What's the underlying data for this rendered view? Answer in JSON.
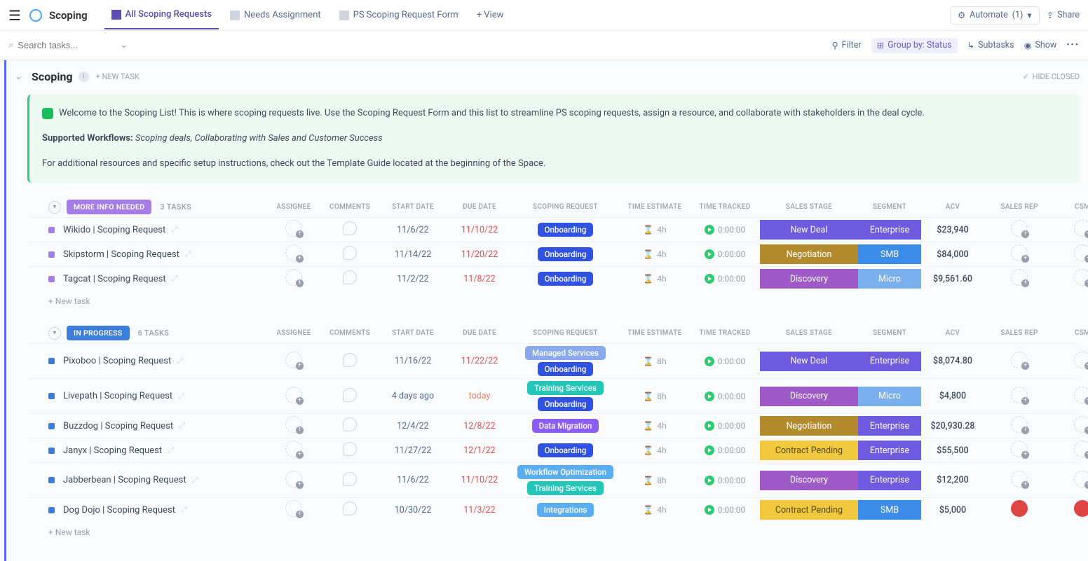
{
  "header": {
    "title": "Scoping",
    "tabs": [
      {
        "label": "All Scoping Requests",
        "active": true
      },
      {
        "label": "Needs Assignment",
        "active": false
      },
      {
        "label": "PS Scoping Request Form",
        "active": false
      }
    ],
    "add_view": "+ View",
    "automate": "Automate",
    "automate_count": "(1)",
    "share": "Share"
  },
  "toolbar": {
    "search_placeholder": "Search tasks...",
    "filter": "Filter",
    "groupby": "Group by: Status",
    "subtasks": "Subtasks",
    "show": "Show"
  },
  "list": {
    "title": "Scoping",
    "new_task": "+ NEW TASK",
    "hide_closed": "HIDE CLOSED",
    "banner": {
      "line1": "Welcome to the Scoping List! This is where scoping requests live. Use the Scoping Request Form and this list to streamline PS scoping requests, assign a resource, and collaborate with stakeholders in the deal cycle.",
      "line2_bold": "Supported Workflows:",
      "line2_italic": "Scoping deals, Collaborating with Sales and Customer Success",
      "line3": "For additional resources and specific setup instructions, check out the Template Guide located at the beginning of the Space."
    }
  },
  "columns": [
    "ASSIGNEE",
    "COMMENTS",
    "START DATE",
    "DUE DATE",
    "SCOPING REQUEST",
    "TIME ESTIMATE",
    "TIME TRACKED",
    "SALES STAGE",
    "SEGMENT",
    "ACV",
    "SALES REP",
    "CSM"
  ],
  "colors": {
    "status_more_info": "#a57de8",
    "status_in_progress": "#3b7dd8",
    "chip_onboarding": "#2f52e0",
    "chip_managed": "#8aa8f0",
    "chip_training": "#24c6b8",
    "chip_datamig": "#8b5cf6",
    "chip_workflow": "#5aaef0",
    "chip_integrations": "#5aaef0",
    "stage_newdeal": "#6f5be0",
    "stage_negotiation": "#b38b2f",
    "stage_discovery": "#9e5bc7",
    "stage_contract": "#f0c93e",
    "seg_enterprise": "#6f5be0",
    "seg_smb": "#3d8be8",
    "seg_micro": "#7bb0ee"
  },
  "groups": [
    {
      "status": "MORE INFO NEEDED",
      "status_color": "#a57de8",
      "count": "3 TASKS",
      "bullet": "#a57de8",
      "tasks": [
        {
          "name": "Wikido | Scoping Request",
          "start": "11/6/22",
          "due": "11/10/22",
          "due_overdue": true,
          "chips": [
            {
              "label": "Onboarding",
              "color": "#2f52e0"
            }
          ],
          "estimate": "4h",
          "tracked": "0:00:00",
          "stage": {
            "label": "New Deal",
            "color": "#6f5be0"
          },
          "segment": {
            "label": "Enterprise",
            "color": "#6f5be0"
          },
          "acv": "$23,940"
        },
        {
          "name": "Skipstorm | Scoping Request",
          "start": "11/14/22",
          "due": "11/20/22",
          "due_overdue": true,
          "chips": [
            {
              "label": "Onboarding",
              "color": "#2f52e0"
            }
          ],
          "estimate": "4h",
          "tracked": "0:00:00",
          "stage": {
            "label": "Negotiation",
            "color": "#b38b2f"
          },
          "segment": {
            "label": "SMB",
            "color": "#3d8be8"
          },
          "acv": "$84,000"
        },
        {
          "name": "Tagcat | Scoping Request",
          "start": "11/2/22",
          "due": "11/8/22",
          "due_overdue": true,
          "chips": [
            {
              "label": "Onboarding",
              "color": "#2f52e0"
            }
          ],
          "estimate": "4h",
          "tracked": "0:00:00",
          "stage": {
            "label": "Discovery",
            "color": "#9e5bc7"
          },
          "segment": {
            "label": "Micro",
            "color": "#7bb0ee"
          },
          "acv": "$9,561.60"
        }
      ]
    },
    {
      "status": "IN PROGRESS",
      "status_color": "#3b7dd8",
      "count": "6 TASKS",
      "bullet": "#3b7dd8",
      "tasks": [
        {
          "name": "Pixoboo | Scoping Request",
          "start": "11/16/22",
          "due": "11/22/22",
          "due_overdue": true,
          "chips": [
            {
              "label": "Managed Services",
              "color": "#8aa8f0"
            },
            {
              "label": "Onboarding",
              "color": "#2f52e0"
            }
          ],
          "estimate": "8h",
          "tracked": "0:00:00",
          "stage": {
            "label": "New Deal",
            "color": "#6f5be0"
          },
          "segment": {
            "label": "Enterprise",
            "color": "#6f5be0"
          },
          "acv": "$8,074.80"
        },
        {
          "name": "Livepath | Scoping Request",
          "start": "4 days ago",
          "due": "today",
          "due_today": true,
          "chips": [
            {
              "label": "Training Services",
              "color": "#24c6b8"
            },
            {
              "label": "Onboarding",
              "color": "#2f52e0"
            }
          ],
          "estimate": "8h",
          "tracked": "0:00:00",
          "stage": {
            "label": "Discovery",
            "color": "#9e5bc7"
          },
          "segment": {
            "label": "Micro",
            "color": "#7bb0ee"
          },
          "acv": "$4,800"
        },
        {
          "name": "Buzzdog | Scoping Request",
          "start": "12/4/22",
          "due": "12/8/22",
          "due_overdue": true,
          "chips": [
            {
              "label": "Data Migration",
              "color": "#8b5cf6"
            }
          ],
          "estimate": "4h",
          "tracked": "0:00:00",
          "stage": {
            "label": "Negotiation",
            "color": "#b38b2f"
          },
          "segment": {
            "label": "Enterprise",
            "color": "#6f5be0"
          },
          "acv": "$20,930.28"
        },
        {
          "name": "Janyx | Scoping Request",
          "start": "11/27/22",
          "due": "12/1/22",
          "due_overdue": true,
          "chips": [
            {
              "label": "Onboarding",
              "color": "#2f52e0"
            }
          ],
          "estimate": "4h",
          "tracked": "0:00:00",
          "stage": {
            "label": "Contract Pending",
            "color": "#f0c93e",
            "text": "#5a4a10"
          },
          "segment": {
            "label": "Enterprise",
            "color": "#6f5be0"
          },
          "acv": "$55,500"
        },
        {
          "name": "Jabberbean | Scoping Request",
          "start": "11/6/22",
          "due": "11/10/22",
          "due_overdue": true,
          "chips": [
            {
              "label": "Workflow Optimization",
              "color": "#5aaef0"
            },
            {
              "label": "Training Services",
              "color": "#24c6b8"
            }
          ],
          "estimate": "8h",
          "tracked": "0:00:00",
          "stage": {
            "label": "Discovery",
            "color": "#9e5bc7"
          },
          "segment": {
            "label": "Enterprise",
            "color": "#6f5be0"
          },
          "acv": "$12,200"
        },
        {
          "name": "Dog Dojo | Scoping Request",
          "start": "10/30/22",
          "due": "11/3/22",
          "due_overdue": true,
          "chips": [
            {
              "label": "Integrations",
              "color": "#5aaef0"
            }
          ],
          "estimate": "4h",
          "tracked": "0:00:00",
          "stage": {
            "label": "Contract Pending",
            "color": "#f0c93e",
            "text": "#5a4a10"
          },
          "segment": {
            "label": "SMB",
            "color": "#3d8be8"
          },
          "acv": "$5,000",
          "rep_avatar": true,
          "csm_avatar": true
        }
      ]
    }
  ],
  "new_task_row": "+ New task"
}
